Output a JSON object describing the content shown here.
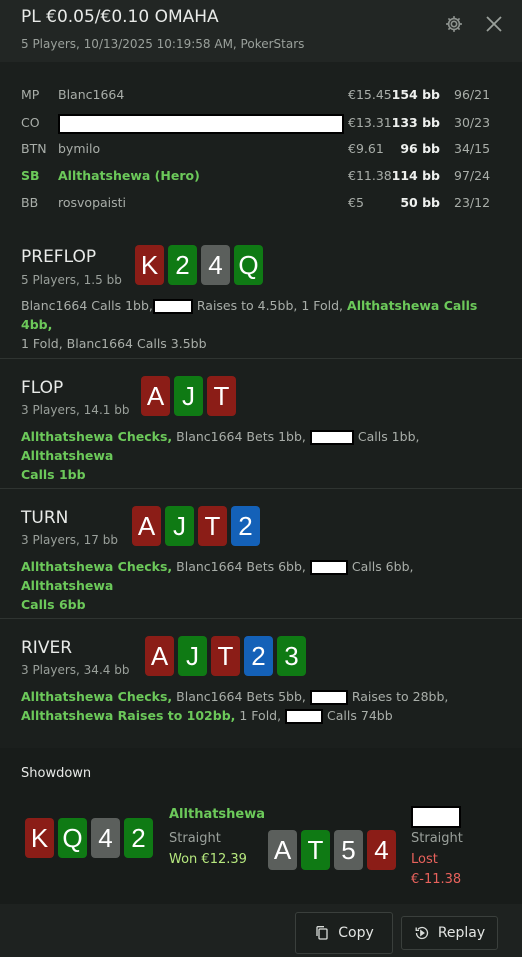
{
  "header": {
    "title": "PL €0.05/€0.10 OMAHA",
    "subtitle": "5 Players, 10/13/2025 10:19:58 AM, PokerStars"
  },
  "players": [
    {
      "pos": "MP",
      "name": "Blanc1664",
      "stack": "€15.45",
      "bb": "154 bb",
      "stat": "96/21"
    },
    {
      "pos": "CO",
      "name": "",
      "stack": "€13.31",
      "bb": "133 bb",
      "stat": "30/23"
    },
    {
      "pos": "BTN",
      "name": "bymilo",
      "stack": "€9.61",
      "bb": "96 bb",
      "stat": "34/15"
    },
    {
      "pos": "SB",
      "name": "Allthatshewa (Hero)",
      "stack": "€11.38",
      "bb": "114 bb",
      "stat": "97/24"
    },
    {
      "pos": "BB",
      "name": "rosvopaisti",
      "stack": "€5",
      "bb": "50 bb",
      "stat": "23/12"
    }
  ],
  "streets": {
    "preflop": {
      "name": "PREFLOP",
      "info": "5 Players, 1.5 bb",
      "cards": [
        "K",
        "2",
        "4",
        "Q"
      ],
      "a1": "Blanc1664 Calls 1bb,",
      "a2": " Raises to 4.5bb, 1 Fold,",
      "a3": "Allthatshewa Calls 4bb,",
      "a4": "1 Fold, Blanc1664 Calls 3.5bb"
    },
    "flop": {
      "name": "FLOP",
      "info": "3 Players, 14.1 bb",
      "cards": [
        "A",
        "J",
        "T"
      ],
      "a1": "Allthatshewa Checks,",
      "a2": "Blanc1664 Bets 1bb,",
      "a3": "Calls 1bb,",
      "a4": "Allthatshewa",
      "a5": "Calls 1bb"
    },
    "turn": {
      "name": "TURN",
      "info": "3 Players, 17 bb",
      "cards": [
        "A",
        "J",
        "T",
        "2"
      ],
      "a1": "Allthatshewa Checks,",
      "a2": "Blanc1664 Bets 6bb,",
      "a3": "Calls 6bb,",
      "a4": "Allthatshewa",
      "a5": "Calls 6bb"
    },
    "river": {
      "name": "RIVER",
      "info": "3 Players, 34.4 bb",
      "cards": [
        "A",
        "J",
        "T",
        "2",
        "3"
      ],
      "a1": "Allthatshewa Checks,",
      "a2": "Blanc1664 Bets 5bb,",
      "a3": "Raises to 28bb,",
      "a4": "Allthatshewa Raises to 102bb,",
      "a5": "1 Fold,",
      "a6": "Calls 74bb"
    }
  },
  "showdown": {
    "title": "Showdown",
    "hero": {
      "name": "Allthatshewa",
      "hand": "Straight",
      "result": "Won €12.39",
      "cards": [
        "K",
        "Q",
        "4",
        "2"
      ]
    },
    "villain": {
      "name": "",
      "hand": "Straight",
      "result1": "Lost",
      "result2": "€-11.38",
      "cards": [
        "A",
        "T",
        "5",
        "4"
      ]
    }
  },
  "footer": {
    "copy_label": "Copy",
    "replay_label": "Replay"
  },
  "colors": {
    "hero_green": "#6cc95a",
    "won": "#b6e87e",
    "lost": "#e8625c",
    "card_red": "#8b1d17",
    "card_green": "#0f7a14",
    "card_gray": "#5b5f5c",
    "card_blue": "#1461b8"
  },
  "icons": [
    "gear-icon",
    "close-icon",
    "copy-icon",
    "replay-icon"
  ]
}
